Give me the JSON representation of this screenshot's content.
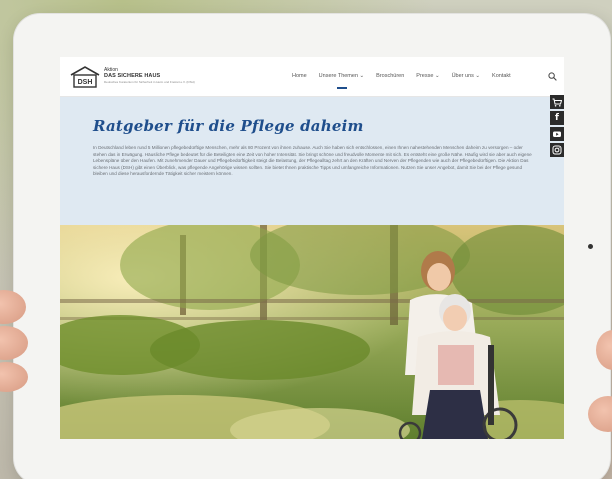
{
  "site": {
    "logo_line1": "Aktion",
    "logo_line2": "DAS SICHERE HAUS",
    "logo_line3": "Deutsches Kuratorium für Sicherheit in Heim und Freizeit e.V. (DSH)",
    "logo_badge": "DSH"
  },
  "nav": {
    "items": [
      {
        "label": "Home"
      },
      {
        "label": "Unsere Themen ⌄"
      },
      {
        "label": "Broschüren"
      },
      {
        "label": "Presse ⌄"
      },
      {
        "label": "Über uns ⌄"
      },
      {
        "label": "Kontakt"
      }
    ],
    "active_index": 1
  },
  "hero": {
    "title": "Ratgeber für die Pflege daheim",
    "text": "In Deutschland leben rund 5 Millionen pflegebedürftige Menschen, mehr als 80 Prozent von ihnen zuhause. Auch Sie haben sich entschlossen, einen Ihnen nahestehenden Menschen daheim zu versorgen – oder stehen das in Erwägung. Häusliche Pflege bedeutet für die Beteiligten eine Zeit von hoher Intensität. Sie bringt schöne und freudvolle Momente mit sich. Es entsteht eine große Nähe. Häufig wird sie aber auch eigene Lebenspläne über den Haufen. Mit zunehmender Dauer und Pflegebedürftigkeit steigt die Belastung, der Pflegealltag zehrt an den Kräften und Nerven der Pflegenden wie auch der Pflegebedürftigen. Die Aktion Das sichere Haus (DSH) gibt einen Überblick, was pflegende Angehörige wissen sollten. Sie bietet Ihnen praktische Tipps und umfangreiche Informationen. Nutzen Sie unser Angebot, damit Sie bei der Pflege gesund bleiben und diese herausfordernde Tätigkeit sicher meistern können."
  },
  "social": [
    {
      "icon": "cart-icon"
    },
    {
      "icon": "facebook-icon",
      "glyph": "f"
    },
    {
      "icon": "youtube-icon"
    },
    {
      "icon": "instagram-icon"
    }
  ],
  "colors": {
    "brand_blue": "#1f4e8c",
    "hero_bg": "#dfe9f2",
    "text_grey": "#6a6f75"
  }
}
